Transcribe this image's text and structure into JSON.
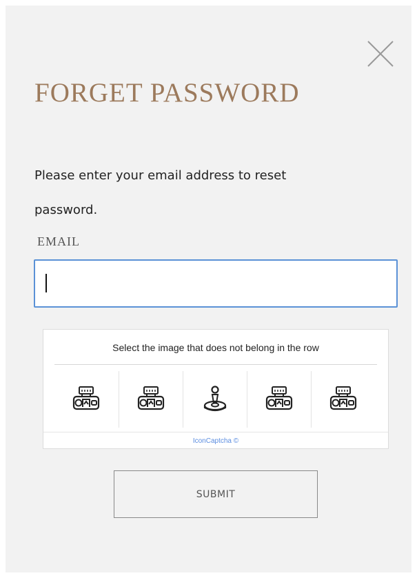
{
  "modal": {
    "title": "FORGET PASSWORD",
    "description": "Please enter your email address to reset password.",
    "email_label": "EMAIL",
    "email_value": "",
    "submit_label": "SUBMIT",
    "close_icon": "close-icon"
  },
  "captcha": {
    "instruction": "Select the image that does not belong in the row",
    "icons": [
      "camera-icon",
      "camera-icon",
      "joystick-icon",
      "camera-icon",
      "camera-icon"
    ],
    "footer": "IconCaptcha ©"
  },
  "colors": {
    "title": "#9c7a5c",
    "input_border": "#5a91d6",
    "captcha_link": "#5b8de0"
  }
}
